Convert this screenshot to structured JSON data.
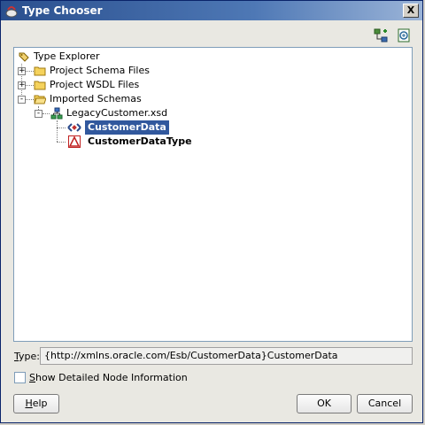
{
  "window": {
    "title": "Type Chooser",
    "close_label": "X"
  },
  "toolbar": {
    "icons": [
      "schema-tree-icon",
      "import-schema-icon"
    ]
  },
  "tree": {
    "root": "Type Explorer",
    "nodes": [
      {
        "label": "Project Schema Files",
        "expander": "+"
      },
      {
        "label": "Project WSDL Files",
        "expander": "+"
      },
      {
        "label": "Imported Schemas",
        "expander": "-"
      },
      {
        "label": "LegacyCustomer.xsd",
        "expander": "-"
      },
      {
        "label": "CustomerData",
        "selected": true
      },
      {
        "label": "CustomerDataType"
      }
    ]
  },
  "type_field": {
    "label_rest": "ype:",
    "label_mnemonic": "T",
    "value": "{http://xmlns.oracle.com/Esb/CustomerData}CustomerData"
  },
  "checkbox": {
    "mnemonic": "S",
    "label_rest": "how Detailed Node Information",
    "checked": false
  },
  "buttons": {
    "help_mnemonic": "H",
    "help_rest": "elp",
    "ok": "OK",
    "cancel": "Cancel"
  }
}
